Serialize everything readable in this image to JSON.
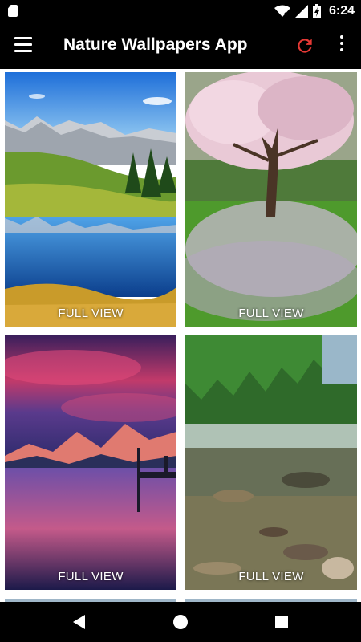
{
  "status_bar": {
    "time": "6:24",
    "icons": [
      "sd-card-icon",
      "wifi-icon",
      "signal-icon",
      "battery-charging-icon"
    ]
  },
  "app_bar": {
    "title": "Nature Wallpapers App",
    "icons": [
      "menu-icon",
      "refresh-icon",
      "more-vert-icon"
    ],
    "refresh_color": "#e53935"
  },
  "wallpapers": [
    {
      "label": "FULL VIEW",
      "subject": "mountain lake"
    },
    {
      "label": "FULL VIEW",
      "subject": "blossom tree"
    },
    {
      "label": "FULL VIEW",
      "subject": "sunset lake"
    },
    {
      "label": "FULL VIEW",
      "subject": "forest river"
    }
  ],
  "nav_bar": {
    "icons": [
      "back-icon",
      "home-icon",
      "recents-icon"
    ]
  }
}
